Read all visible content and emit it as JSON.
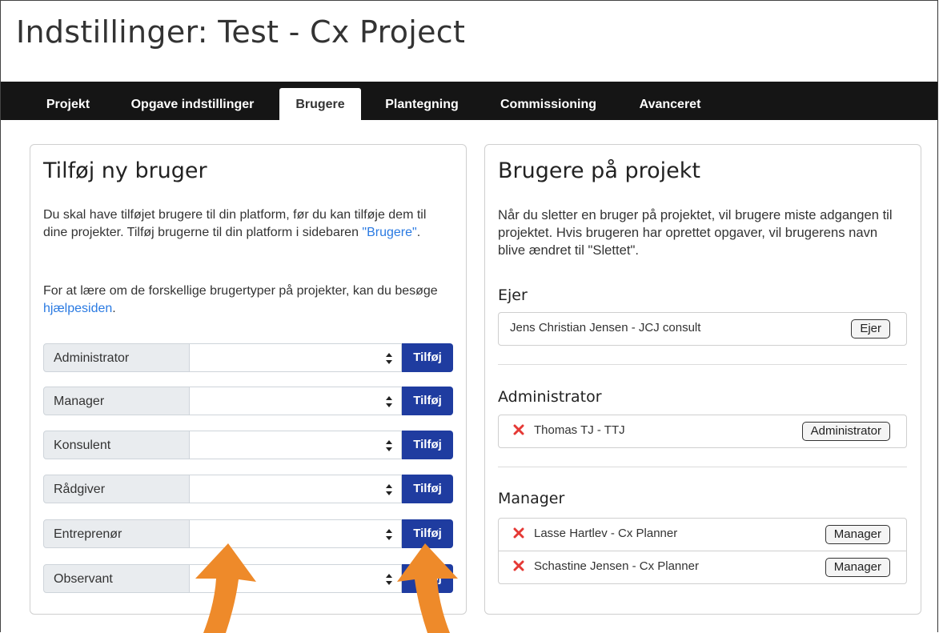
{
  "page": {
    "title": "Indstillinger: Test - Cx Project"
  },
  "nav": {
    "tabs": [
      {
        "label": "Projekt",
        "active": false
      },
      {
        "label": "Opgave indstillinger",
        "active": false
      },
      {
        "label": "Brugere",
        "active": true
      },
      {
        "label": "Plantegning",
        "active": false
      },
      {
        "label": "Commissioning",
        "active": false
      },
      {
        "label": "Avanceret",
        "active": false
      }
    ]
  },
  "add_user": {
    "title": "Tilføj ny bruger",
    "para1_a": "Du skal have tilføjet brugere til din platform, før du kan tilføje dem til dine projekter. Tilføj brugerne til din platform i sidebaren ",
    "para1_link": "\"Brugere\"",
    "para1_end": ".",
    "para2_a": "For at lære om de forskellige brugertyper på projekter, kan du besøge ",
    "para2_link": "hjælpesiden",
    "para2_end": ".",
    "roles": [
      {
        "label": "Administrator",
        "button": "Tilføj"
      },
      {
        "label": "Manager",
        "button": "Tilføj"
      },
      {
        "label": "Konsulent",
        "button": "Tilføj"
      },
      {
        "label": "Rådgiver",
        "button": "Tilføj"
      },
      {
        "label": "Entreprenør",
        "button": "Tilføj"
      },
      {
        "label": "Observant",
        "button": "Tilføj"
      }
    ]
  },
  "project_users": {
    "title": "Brugere på projekt",
    "description": "Når du sletter en bruger på projektet, vil brugere miste adgangen til projektet. Hvis brugeren har oprettet opgaver, vil brugerens navn blive ændret til \"Slettet\".",
    "groups": [
      {
        "heading": "Ejer",
        "users": [
          {
            "name": "Jens Christian Jensen - JCJ consult",
            "role": "Ejer",
            "deletable": false
          }
        ]
      },
      {
        "heading": "Administrator",
        "users": [
          {
            "name": "Thomas TJ - TTJ",
            "role": "Administrator",
            "deletable": true
          }
        ]
      },
      {
        "heading": "Manager",
        "users": [
          {
            "name": "Lasse Hartlev - Cx Planner",
            "role": "Manager",
            "deletable": true
          },
          {
            "name": "Schastine Jensen - Cx Planner",
            "role": "Manager",
            "deletable": true
          }
        ]
      }
    ]
  },
  "colors": {
    "accent": "#1f3ca0",
    "navbar": "#151515",
    "arrow": "#ee8a2a",
    "delete": "#e53935",
    "link": "#2a7ae2"
  },
  "icons": {
    "select_arrow": "up-down-caret-icon",
    "delete": "close-x-icon",
    "annotation": "up-arrow-icon"
  }
}
